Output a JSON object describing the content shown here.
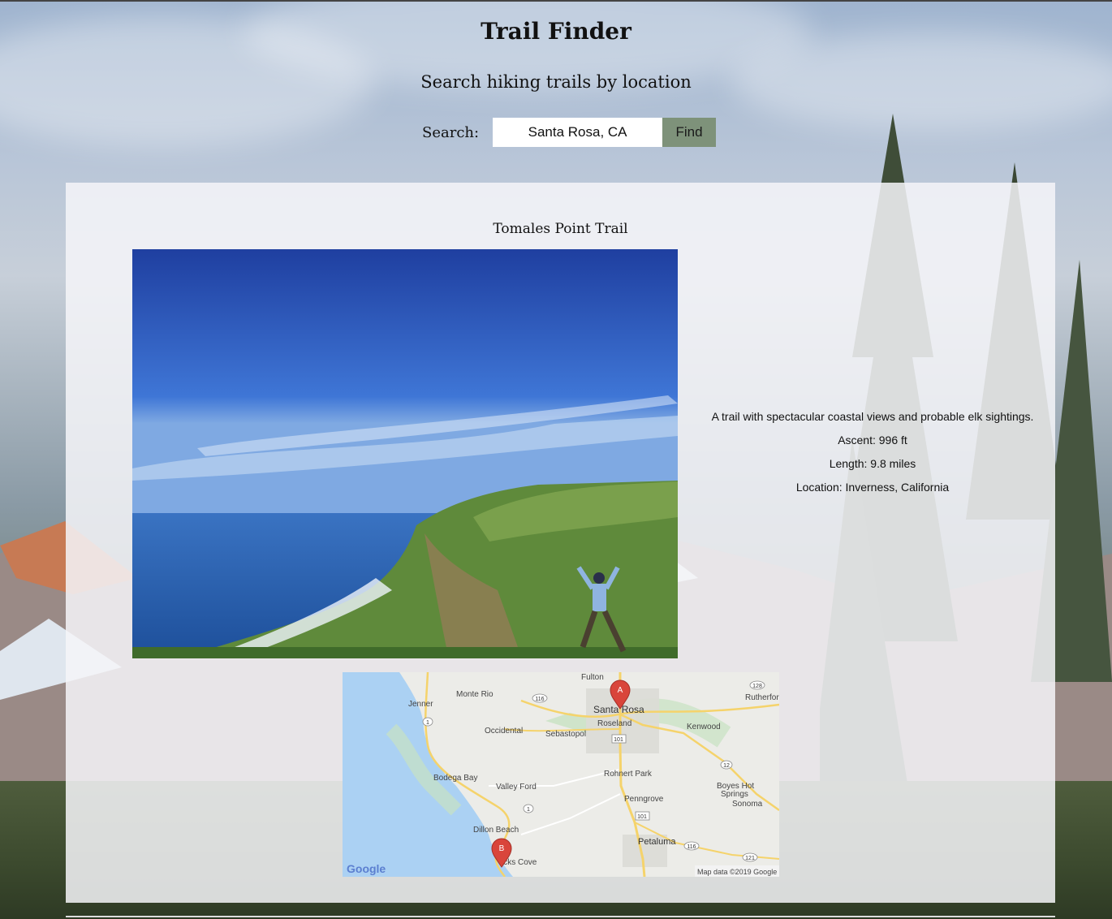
{
  "header": {
    "title": "Trail Finder",
    "subtitle": "Search hiking trails by location"
  },
  "search": {
    "label": "Search:",
    "value": "Santa Rosa, CA",
    "button_label": "Find"
  },
  "result": {
    "name": "Tomales Point Trail",
    "description": "A trail with spectacular coastal views and probable elk sightings.",
    "ascent": "Ascent: 996 ft",
    "length": "Length: 9.8 miles",
    "location": "Location: Inverness, California"
  },
  "map": {
    "places": {
      "fulton": "Fulton",
      "monte_rio": "Monte Rio",
      "jenner": "Jenner",
      "santa_rosa": "Santa Rosa",
      "roseland": "Roseland",
      "occidental": "Occidental",
      "sebastopol": "Sebastopol",
      "kenwood": "Kenwood",
      "rutherford": "Rutherfor",
      "bodega_bay": "Bodega Bay",
      "valley_ford": "Valley Ford",
      "rohnert_park": "Rohnert Park",
      "penngrove": "Penngrove",
      "boyes_hot_springs_1": "Boyes Hot",
      "boyes_hot_springs_2": "Springs",
      "sonoma": "Sonoma",
      "dillon_beach": "Dillon Beach",
      "petaluma": "Petaluma",
      "marshall": "icks Cove"
    },
    "routes": {
      "r1a": "1",
      "r1b": "1",
      "r116a": "116",
      "r116b": "116",
      "r101a": "101",
      "r101b": "101",
      "r12": "12",
      "r128": "128",
      "r121": "121"
    },
    "marker_a": "A",
    "marker_b": "B",
    "logo": "Google",
    "attribution": "Map data ©2019 Google"
  },
  "colors": {
    "find_button": "#7e927a",
    "panel": "#f5f5f8",
    "marker": "#d9453b",
    "water": "#abd1f3"
  }
}
